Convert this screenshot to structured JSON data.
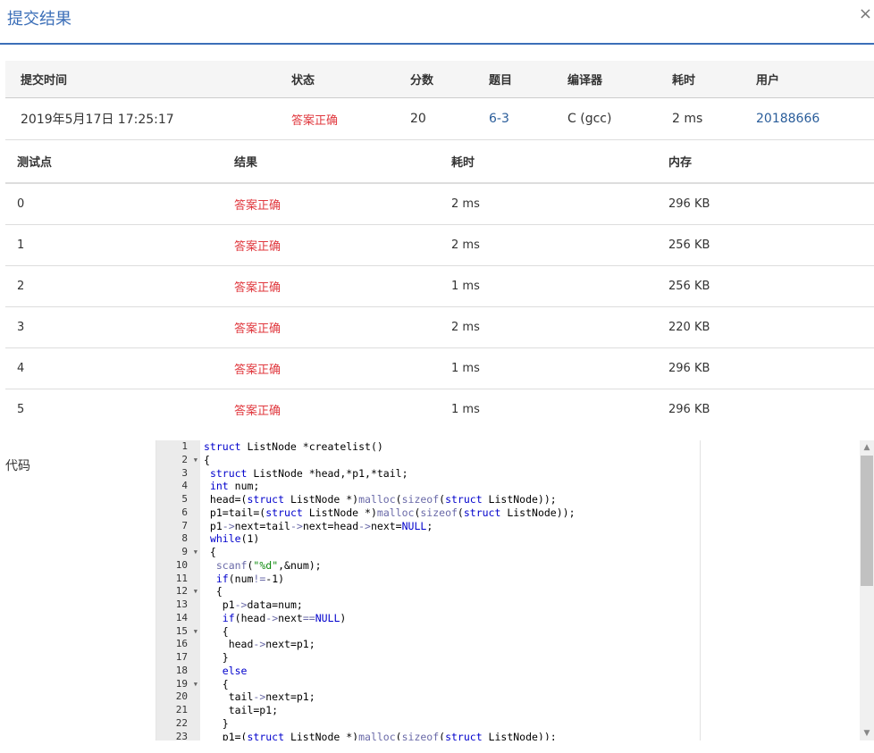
{
  "dialog": {
    "title": "提交结果",
    "close_icon": "×"
  },
  "summary": {
    "headers": [
      "提交时间",
      "状态",
      "分数",
      "题目",
      "编译器",
      "耗时",
      "用户"
    ],
    "row": {
      "time": "2019年5月17日 17:25:17",
      "status": "答案正确",
      "score": "20",
      "problem": "6-3",
      "compiler": "C (gcc)",
      "elapsed": "2 ms",
      "user": "20188666"
    }
  },
  "cases": {
    "headers": [
      "测试点",
      "结果",
      "耗时",
      "内存"
    ],
    "rows": [
      {
        "id": "0",
        "result": "答案正确",
        "time": "2 ms",
        "memory": "296 KB"
      },
      {
        "id": "1",
        "result": "答案正确",
        "time": "2 ms",
        "memory": "256 KB"
      },
      {
        "id": "2",
        "result": "答案正确",
        "time": "1 ms",
        "memory": "256 KB"
      },
      {
        "id": "3",
        "result": "答案正确",
        "time": "2 ms",
        "memory": "220 KB"
      },
      {
        "id": "4",
        "result": "答案正确",
        "time": "1 ms",
        "memory": "296 KB"
      },
      {
        "id": "5",
        "result": "答案正确",
        "time": "1 ms",
        "memory": "296 KB"
      }
    ]
  },
  "code": {
    "label": "代码",
    "fold_lines": [
      2,
      9,
      12,
      15,
      19
    ],
    "lines": [
      "struct ListNode *createlist()",
      "{",
      " struct ListNode *head,*p1,*tail;",
      " int num;",
      " head=(struct ListNode *)malloc(sizeof(struct ListNode));",
      " p1=tail=(struct ListNode *)malloc(sizeof(struct ListNode));",
      " p1->next=tail->next=head->next=NULL;",
      " while(1)",
      " {",
      "  scanf(\"%d\",&num);",
      "  if(num!=-1)",
      "  {",
      "   p1->data=num;",
      "   if(head->next==NULL)",
      "   {",
      "    head->next=p1;",
      "   }",
      "   else",
      "   {",
      "    tail->next=p1;",
      "    tail=p1;",
      "   }",
      "   p1=(struct ListNode *)malloc(sizeof(struct ListNode));"
    ]
  },
  "colors": {
    "accent": "#3c6fb8",
    "ok": "#e0383e",
    "link": "#2a5d9a"
  }
}
